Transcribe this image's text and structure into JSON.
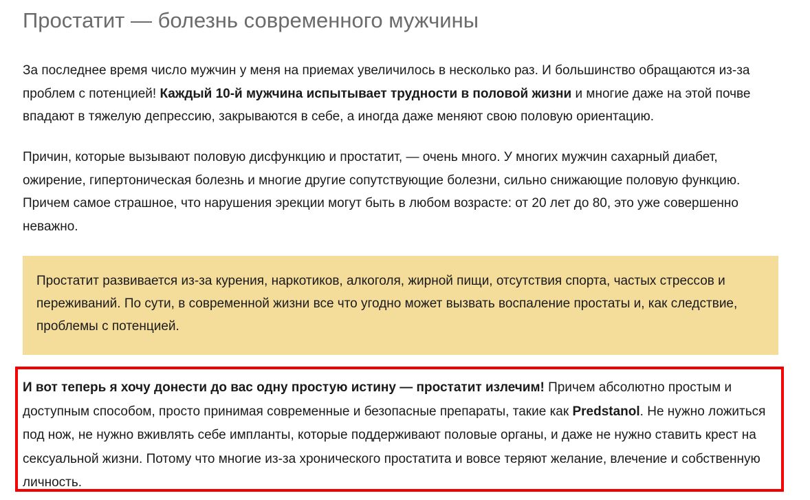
{
  "article": {
    "title": "Простатит — болезнь современного мужчины",
    "paragraph1": {
      "text_before": "За последнее время число мужчин у меня на приемах увеличилось в несколько раз. И большинство обращаются из-за проблем с потенцией! ",
      "bold": "Каждый 10-й мужчина испытывает трудности в половой жизни",
      "text_after": " и многие даже на этой почве впадают в тяжелую депрессию, закрываются в себе, а иногда даже меняют свою половую ориентацию."
    },
    "paragraph2": {
      "text": "Причин, которые вызывают половую дисфункцию и простатит, — очень много. У многих мужчин сахарный диабет, ожирение, гипертоническая болезнь и многие другие сопутствующие болезни, сильно снижающие половую функцию. Причем самое страшное, что нарушения эрекции могут быть в любом возрасте: от 20 лет до 80, это уже совершенно неважно."
    },
    "callout": {
      "text": "Простатит развивается из-за курения, наркотиков, алкоголя, жирной пищи, отсутствия спорта, частых стрессов и переживаний. По сути, в современной жизни все что угодно может вызвать воспаление простаты и, как следствие, проблемы с потенцией.",
      "background_color": "#f4dc9b"
    },
    "highlight": {
      "bold_intro": "И вот теперь я хочу донести до вас одну простую истину — простатит излечим!",
      "text_middle": " Причем абсолютно простым и доступным способом, просто принимая современные и безопасные препараты, такие как ",
      "product_name": "Predstanol",
      "text_after": ". Не нужно ложиться под нож, не нужно вживлять себе импланты, которые поддерживают половые органы, и даже не нужно ставить крест на сексуальной жизни. Потому что многие из-за хронического простатита и вовсе теряют желание, влечение и собственную личность.",
      "border_color": "#f50000"
    }
  }
}
